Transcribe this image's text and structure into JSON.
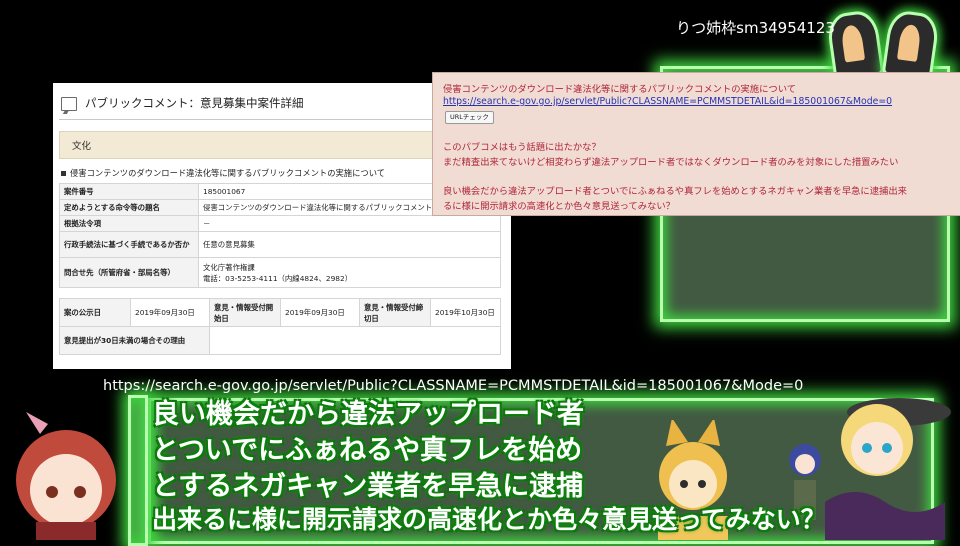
{
  "credit": "りつ姉枠sm34954123",
  "panel": {
    "title": "パブリックコメント：意見募集中案件詳細",
    "category": "文化",
    "subject": "侵害コンテンツのダウンロード違法化等に関するパブリックコメントの実施について",
    "rows": [
      {
        "label": "案件番号",
        "value": "185001067"
      },
      {
        "label": "定めようとする命令等の題名",
        "value": "侵害コンテンツのダウンロード違法化等に関するパブリックコメント"
      },
      {
        "label": "根拠法令項",
        "value": "－"
      },
      {
        "label": "行政手続法に基づく手続であるか否か",
        "value": "任意の意見募集"
      },
      {
        "label": "問合せ先（所管府省・部局名等）",
        "value": "文化庁著作権課",
        "value2": "電話：03-5253-4111（内線4824、2982）"
      }
    ],
    "dates": {
      "announce_label": "案の公示日",
      "announce": "2019年09月30日",
      "start_label": "意見・情報受付開始日",
      "start": "2019年09月30日",
      "end_label": "意見・情報受付締切日",
      "end": "2019年10月30日",
      "reason_label": "意見提出が30日未満の場合その理由",
      "reason": ""
    }
  },
  "note": {
    "line1": "侵害コンテンツのダウンロード違法化等に関するパブリックコメントの実施について",
    "url": "https://search.e-gov.go.jp/servlet/Public?CLASSNAME=PCMMSTDETAIL&id=185001067&Mode=0",
    "url_button": "URLチェック",
    "line2": "このパブコメはもう話題に出たかな？",
    "line3": "まだ精査出来てないけど相変わらず違法アップロード者ではなくダウンロード者のみを対象にした措置みたい",
    "line4": "良い機会だから違法アップロード者とついでにふぁねるや真フレを始めとするネガキャン業者を早急に逮捕出来",
    "line5": "るに様に開示請求の高速化とか色々意見送ってみない？"
  },
  "bottom_url": "https://search.e-gov.go.jp/servlet/Public?CLASSNAME=PCMMSTDETAIL&id=185001067&Mode=0",
  "subtitles": [
    "良い機会だから違法アップロード者",
    "とついでにふぁねるや真フレを始め",
    "とするネガキャン業者を早急に逮捕",
    "出来るに様に開示請求の高速化とか色々意見送ってみない？"
  ]
}
